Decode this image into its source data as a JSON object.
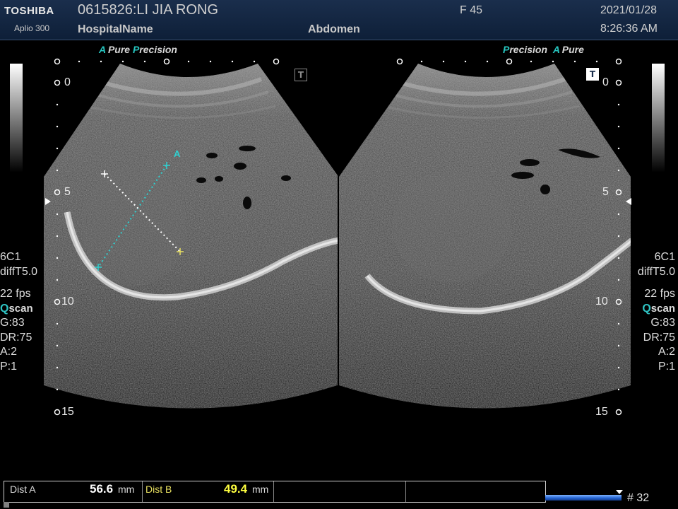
{
  "header": {
    "brand": "TOSHIBA",
    "model": "Aplio 300",
    "patient": "0615826:LI JIA RONG",
    "hospital": "HospitalName",
    "exam": "Abdomen",
    "frame_label": "F  45",
    "date": "2021/01/28",
    "time": "8:26:36 AM"
  },
  "left_image": {
    "brand_a": "A",
    "brand_pure": "Pure",
    "brand_p": "P",
    "brand_precision": "recision",
    "t_marker": "T"
  },
  "right_image": {
    "brand_p": "P",
    "brand_precision": "recision",
    "brand_a": "A",
    "brand_pure": "Pure",
    "t_marker": "T"
  },
  "depth_marks": [
    "0",
    "5",
    "10",
    "15"
  ],
  "params_left": {
    "probe": "6C1",
    "mode": "diffT5.0",
    "fps": "22 fps",
    "qscan_q": "Q",
    "qscan_rest": "scan",
    "gain": "G:83",
    "dr": "DR:75",
    "a": "A:2",
    "p": "P:1"
  },
  "params_right": {
    "probe": "6C1",
    "mode": "diffT5.0",
    "fps": "22 fps",
    "qscan_q": "Q",
    "qscan_rest": "scan",
    "gain": "G:83",
    "dr": "DR:75",
    "a": "A:2",
    "p": "P:1"
  },
  "caliper_label": "A",
  "measurements": {
    "dist_a_label": "Dist A",
    "dist_a_value": "56.6",
    "dist_a_unit": "mm",
    "dist_b_label": "Dist B",
    "dist_b_value": "49.4",
    "dist_b_unit": "mm"
  },
  "cine": {
    "frame_count": "# 32"
  },
  "colors": {
    "header_bg": "#13263f",
    "accent_cyan": "#27c6c0",
    "dist_b_value": "#ffff40",
    "caliper_b": "#e8e060",
    "cine_bar": "#2060d0"
  }
}
